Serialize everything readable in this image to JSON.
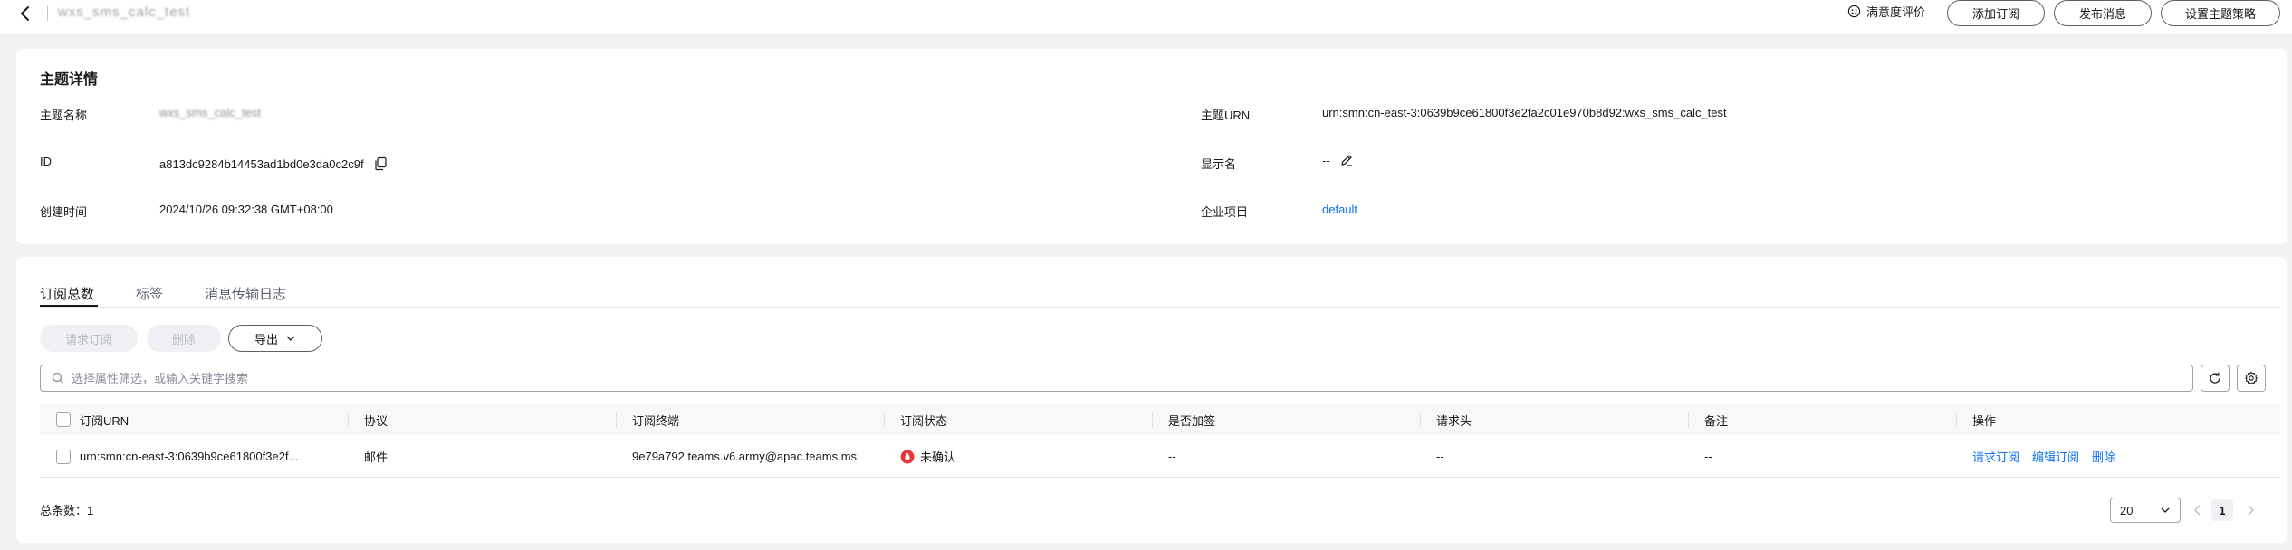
{
  "header": {
    "title": "wxs_sms_calc_test",
    "satisfaction_label": "满意度评价",
    "buttons": {
      "add_subscription": "添加订阅",
      "publish_message": "发布消息",
      "set_topic_policy": "设置主题策略"
    }
  },
  "detail": {
    "section_title": "主题详情",
    "topic_name_label": "主题名称",
    "topic_name_value": "wxs_sms_calc_test",
    "id_label": "ID",
    "id_value": "a813dc9284b14453ad1bd0e3da0c2c9f",
    "created_label": "创建时间",
    "created_value": "2024/10/26 09:32:38 GMT+08:00",
    "urn_label": "主题URN",
    "urn_value": "urn:smn:cn-east-3:0639b9ce61800f3e2fa2c01e970b8d92:wxs_sms_calc_test",
    "display_name_label": "显示名",
    "display_name_value": "--",
    "project_label": "企业项目",
    "project_value": "default"
  },
  "tabs": [
    "订阅总数",
    "标签",
    "消息传输日志"
  ],
  "toolbar": {
    "request_subscription": "请求订阅",
    "delete": "删除",
    "export": "导出"
  },
  "search": {
    "placeholder": "选择属性筛选，或输入关键字搜索"
  },
  "table": {
    "columns": [
      "订阅URN",
      "协议",
      "订阅终端",
      "订阅状态",
      "是否加签",
      "请求头",
      "备注",
      "操作"
    ],
    "rows": [
      {
        "urn": "urn:smn:cn-east-3:0639b9ce61800f3e2f...",
        "protocol": "邮件",
        "endpoint": "9e79a792.teams.v6.army@apac.teams.ms",
        "status": "未确认",
        "signed": "--",
        "headers": "--",
        "remark": "--",
        "actions": [
          "请求订阅",
          "编辑订阅",
          "删除"
        ]
      }
    ]
  },
  "footer": {
    "total_label": "总条数：",
    "total_value": "1",
    "page_size": "20",
    "current_page": "1"
  },
  "colors": {
    "link": "#0a6ef0",
    "status_unconfirmed": "#e6373c"
  }
}
